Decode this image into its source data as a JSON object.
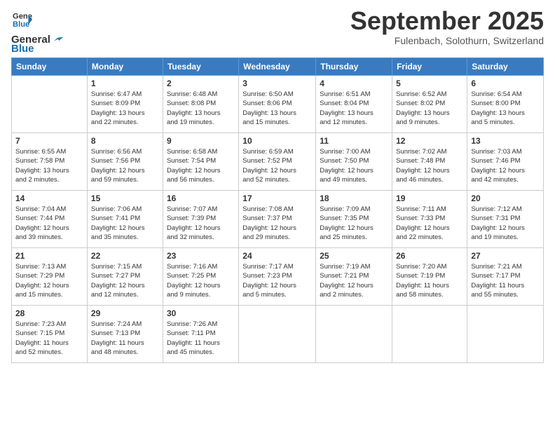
{
  "header": {
    "logo_line1": "General",
    "logo_line2": "Blue",
    "month": "September 2025",
    "location": "Fulenbach, Solothurn, Switzerland"
  },
  "days_of_week": [
    "Sunday",
    "Monday",
    "Tuesday",
    "Wednesday",
    "Thursday",
    "Friday",
    "Saturday"
  ],
  "weeks": [
    [
      {
        "day": "",
        "info": ""
      },
      {
        "day": "1",
        "info": "Sunrise: 6:47 AM\nSunset: 8:09 PM\nDaylight: 13 hours\nand 22 minutes."
      },
      {
        "day": "2",
        "info": "Sunrise: 6:48 AM\nSunset: 8:08 PM\nDaylight: 13 hours\nand 19 minutes."
      },
      {
        "day": "3",
        "info": "Sunrise: 6:50 AM\nSunset: 8:06 PM\nDaylight: 13 hours\nand 15 minutes."
      },
      {
        "day": "4",
        "info": "Sunrise: 6:51 AM\nSunset: 8:04 PM\nDaylight: 13 hours\nand 12 minutes."
      },
      {
        "day": "5",
        "info": "Sunrise: 6:52 AM\nSunset: 8:02 PM\nDaylight: 13 hours\nand 9 minutes."
      },
      {
        "day": "6",
        "info": "Sunrise: 6:54 AM\nSunset: 8:00 PM\nDaylight: 13 hours\nand 5 minutes."
      }
    ],
    [
      {
        "day": "7",
        "info": "Sunrise: 6:55 AM\nSunset: 7:58 PM\nDaylight: 13 hours\nand 2 minutes."
      },
      {
        "day": "8",
        "info": "Sunrise: 6:56 AM\nSunset: 7:56 PM\nDaylight: 12 hours\nand 59 minutes."
      },
      {
        "day": "9",
        "info": "Sunrise: 6:58 AM\nSunset: 7:54 PM\nDaylight: 12 hours\nand 56 minutes."
      },
      {
        "day": "10",
        "info": "Sunrise: 6:59 AM\nSunset: 7:52 PM\nDaylight: 12 hours\nand 52 minutes."
      },
      {
        "day": "11",
        "info": "Sunrise: 7:00 AM\nSunset: 7:50 PM\nDaylight: 12 hours\nand 49 minutes."
      },
      {
        "day": "12",
        "info": "Sunrise: 7:02 AM\nSunset: 7:48 PM\nDaylight: 12 hours\nand 46 minutes."
      },
      {
        "day": "13",
        "info": "Sunrise: 7:03 AM\nSunset: 7:46 PM\nDaylight: 12 hours\nand 42 minutes."
      }
    ],
    [
      {
        "day": "14",
        "info": "Sunrise: 7:04 AM\nSunset: 7:44 PM\nDaylight: 12 hours\nand 39 minutes."
      },
      {
        "day": "15",
        "info": "Sunrise: 7:06 AM\nSunset: 7:41 PM\nDaylight: 12 hours\nand 35 minutes."
      },
      {
        "day": "16",
        "info": "Sunrise: 7:07 AM\nSunset: 7:39 PM\nDaylight: 12 hours\nand 32 minutes."
      },
      {
        "day": "17",
        "info": "Sunrise: 7:08 AM\nSunset: 7:37 PM\nDaylight: 12 hours\nand 29 minutes."
      },
      {
        "day": "18",
        "info": "Sunrise: 7:09 AM\nSunset: 7:35 PM\nDaylight: 12 hours\nand 25 minutes."
      },
      {
        "day": "19",
        "info": "Sunrise: 7:11 AM\nSunset: 7:33 PM\nDaylight: 12 hours\nand 22 minutes."
      },
      {
        "day": "20",
        "info": "Sunrise: 7:12 AM\nSunset: 7:31 PM\nDaylight: 12 hours\nand 19 minutes."
      }
    ],
    [
      {
        "day": "21",
        "info": "Sunrise: 7:13 AM\nSunset: 7:29 PM\nDaylight: 12 hours\nand 15 minutes."
      },
      {
        "day": "22",
        "info": "Sunrise: 7:15 AM\nSunset: 7:27 PM\nDaylight: 12 hours\nand 12 minutes."
      },
      {
        "day": "23",
        "info": "Sunrise: 7:16 AM\nSunset: 7:25 PM\nDaylight: 12 hours\nand 9 minutes."
      },
      {
        "day": "24",
        "info": "Sunrise: 7:17 AM\nSunset: 7:23 PM\nDaylight: 12 hours\nand 5 minutes."
      },
      {
        "day": "25",
        "info": "Sunrise: 7:19 AM\nSunset: 7:21 PM\nDaylight: 12 hours\nand 2 minutes."
      },
      {
        "day": "26",
        "info": "Sunrise: 7:20 AM\nSunset: 7:19 PM\nDaylight: 11 hours\nand 58 minutes."
      },
      {
        "day": "27",
        "info": "Sunrise: 7:21 AM\nSunset: 7:17 PM\nDaylight: 11 hours\nand 55 minutes."
      }
    ],
    [
      {
        "day": "28",
        "info": "Sunrise: 7:23 AM\nSunset: 7:15 PM\nDaylight: 11 hours\nand 52 minutes."
      },
      {
        "day": "29",
        "info": "Sunrise: 7:24 AM\nSunset: 7:13 PM\nDaylight: 11 hours\nand 48 minutes."
      },
      {
        "day": "30",
        "info": "Sunrise: 7:26 AM\nSunset: 7:11 PM\nDaylight: 11 hours\nand 45 minutes."
      },
      {
        "day": "",
        "info": ""
      },
      {
        "day": "",
        "info": ""
      },
      {
        "day": "",
        "info": ""
      },
      {
        "day": "",
        "info": ""
      }
    ]
  ]
}
